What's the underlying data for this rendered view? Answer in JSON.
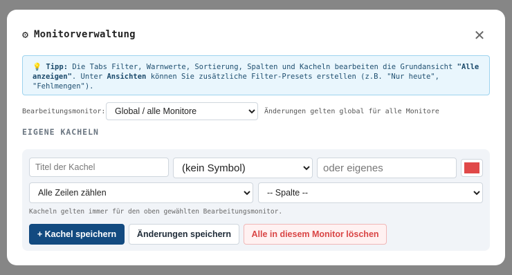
{
  "modal": {
    "title": "Monitorverwaltung",
    "close_icon": "close-icon",
    "header_icon": "gear-icon"
  },
  "tip": {
    "icon": "lightbulb-icon",
    "prefix": "Tipp:",
    "text_1": " Die Tabs Filter, Warnwerte, Sortierung, Spalten und Kacheln bearbeiten die Grundansicht ",
    "highlight_1": "\"Alle anzeigen\"",
    "text_2": ". Unter ",
    "highlight_2": "Ansichten",
    "text_3": " können Sie zusätzliche Filter-Presets erstellen (z.B. \"Nur heute\", \"Fehlmengen\")."
  },
  "monitor": {
    "label": "Bearbeitungsmonitor:",
    "selected": "Global / alle Monitore",
    "note": "Änderungen gelten global für alle Monitore"
  },
  "tiles": {
    "section_title": "EIGENE KACHELN",
    "title_placeholder": "Titel der Kachel",
    "symbol_selected": "(kein Symbol)",
    "own_placeholder": "oder eigenes",
    "color": "#e04848",
    "count_selected": "Alle Zeilen zählen",
    "column_selected": "-- Spalte --",
    "note": "Kacheln gelten immer für den oben gewählten Bearbeitungsmonitor.",
    "save_tile_label": "+ Kachel speichern",
    "save_changes_label": "Änderungen speichern",
    "delete_all_label": "Alle in diesem Monitor löschen"
  }
}
